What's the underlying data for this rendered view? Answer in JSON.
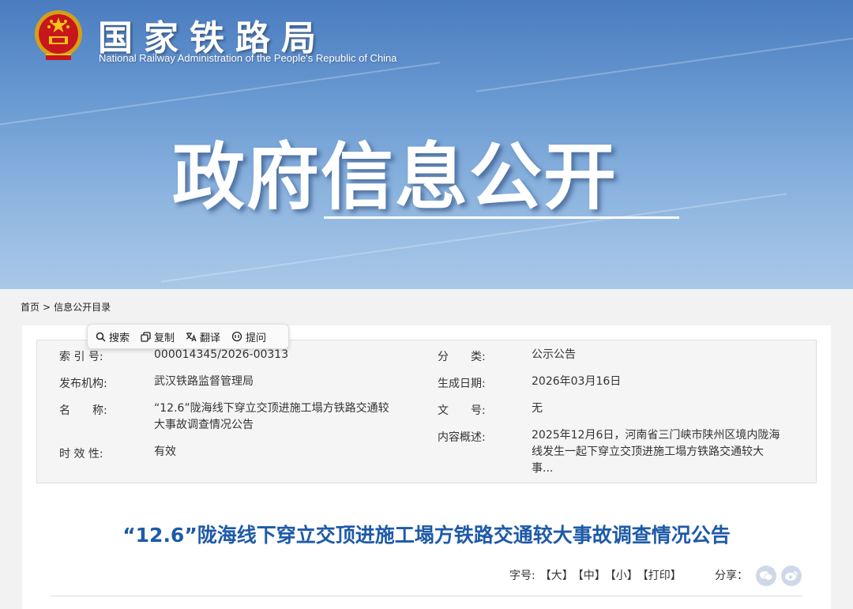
{
  "header": {
    "site_title": "国家铁路局",
    "site_subtitle": "National Railway Administration of the People's Republic of China",
    "hero_title": "政府信息公开"
  },
  "breadcrumb": {
    "home": "首页",
    "separator": ">",
    "current": "信息公开目录"
  },
  "popup_toolbar": {
    "search": "搜索",
    "copy": "复制",
    "translate": "翻译",
    "ask": "提问"
  },
  "info": {
    "index_label": "索 引 号:",
    "index_value": "000014345/2026-00313",
    "category_label": "分　　类:",
    "category_value": "公示公告",
    "publisher_label": "发布机构:",
    "publisher_value": "武汉铁路监督管理局",
    "date_label": "生成日期:",
    "date_value": "2026年03月16日",
    "name_label": "名　　称:",
    "name_value_line1": "“12.6”陇海线下穿立交顶进施工塌方铁路交通较",
    "name_value_line2": "大事故调查情况公告",
    "docno_label": "文　　号:",
    "docno_value": "无",
    "summary_label": "内容概述:",
    "summary_line1": "2025年12月6日，河南省三门峡市陕州区境内陇海",
    "summary_line2": "线发生一起下穿立交顶进施工塌方铁路交通较大",
    "summary_line3": "事...",
    "validity_label": "时 效 性:",
    "validity_value": "有效"
  },
  "article": {
    "title": "“12.6”陇海线下穿立交顶进施工塌方铁路交通较大事故调查情况公告",
    "font_label": "字号:",
    "font_large": "【大】",
    "font_medium": "【中】",
    "font_small": "【小】",
    "print": "【打印】",
    "share_label": "分享："
  },
  "colors": {
    "title_blue": "#1e5aa8",
    "banner_top": "#4a7cc0",
    "banner_bottom": "#a9c8e8"
  },
  "icons": [
    "national-emblem-icon",
    "search-icon",
    "copy-icon",
    "translate-icon",
    "ask-icon",
    "wechat-icon",
    "weibo-icon"
  ]
}
